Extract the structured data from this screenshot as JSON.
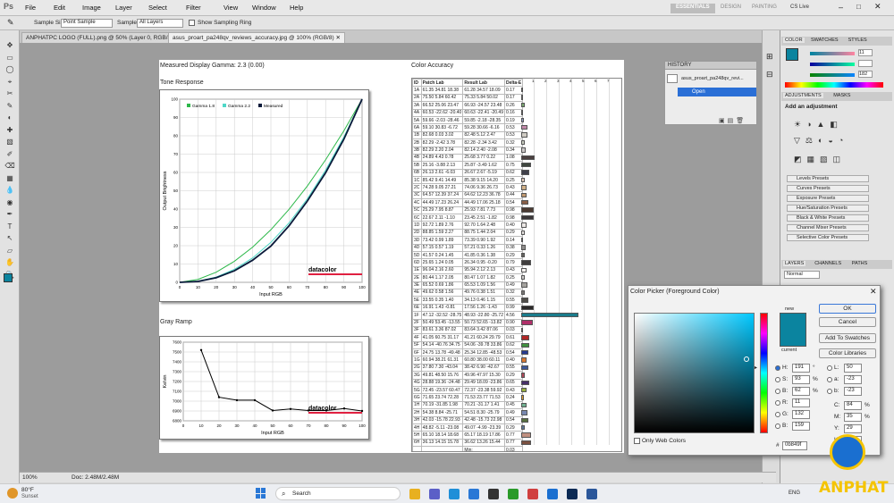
{
  "app": {
    "logo": "Ps"
  },
  "menu": [
    "File",
    "Edit",
    "Image",
    "Layer",
    "Select",
    "Filter",
    "View",
    "Window",
    "Help"
  ],
  "workspace": {
    "essentials": "ESSENTIALS",
    "design": "DESIGN",
    "painting": "PAINTING",
    "cslive": "CS Live"
  },
  "options": {
    "sample_size_label": "Sample Size:",
    "sample_size_value": "Point Sample",
    "sample_label": "Sample:",
    "sample_value": "All Layers",
    "show_ring": "Show Sampling Ring"
  },
  "tabs": [
    {
      "label": "ANPHATPC LOGO (FULL).png @ 50% (Layer 0, RGB/8) *"
    },
    {
      "label": "asus_proart_pa248qv_reviews_accuracy.jpg @ 100% (RGB/8)"
    }
  ],
  "doc": {
    "gamma_title": "Measured Display Gamma: 2.3 (0.00)",
    "tone_title": "Tone Response",
    "tone_ylabel": "Output Brightness",
    "tone_xlabel": "Input RGB",
    "legend": [
      "Gamma 1.8",
      "Gamma 2.2",
      "Measured"
    ],
    "gray_title": "Gray Ramp",
    "gray_ylabel": "Kelvin",
    "gray_xlabel": "Input RGB",
    "brand": "datacolor",
    "ca_title": "Color Accuracy",
    "ca_headers": [
      "ID",
      "Patch Lab",
      "Result Lab",
      "Delta-E"
    ],
    "ca_scale": [
      "1",
      "2",
      "3",
      "4",
      "5",
      "6",
      "7"
    ],
    "ca_rows": [
      [
        "1A",
        "61.35 34.81 18.38",
        "61.28 34.57 18.09",
        "0.17",
        "#c89a8a"
      ],
      [
        "2A",
        "75.50 5.84 60.42",
        "75.33 5.84 50.02",
        "0.17",
        "#d8c47a"
      ],
      [
        "3A",
        "66.52 25.06 23.47",
        "66.93 -24.57 23.48",
        "0.26",
        "#7aa870"
      ],
      [
        "4A",
        "60.53 -22.62 -20.40",
        "60.63 -22.41 -20.49",
        "0.16",
        "#5aa0b0"
      ],
      [
        "5A",
        "59.66 -2.03 -28.46",
        "59.85 -2.18 -28.35",
        "0.19",
        "#8898c0"
      ],
      [
        "6A",
        "59.10 30.83 -6.72",
        "59.28 30.66 -6.16",
        "0.53",
        "#c088a8"
      ],
      [
        "1B",
        "82.68 0.03 3.02",
        "82.48 5.12 2.47",
        "0.53",
        "#d0ccc4"
      ],
      [
        "2B",
        "82.29 -2.42 3.78",
        "82.28 -2.34 3.42",
        "0.32",
        "#c8ccc0"
      ],
      [
        "3B",
        "82.29 2.20 2.04",
        "82.14 2.40 -2.08",
        "0.34",
        "#ccc8c8"
      ],
      [
        "4B",
        "24.89 4.43 0.78",
        "25.68 3.77 0.22",
        "1.08",
        "#4a4040"
      ],
      [
        "5B",
        "25.16 -3.88 2.13",
        "25.87 -3.49 1.62",
        "0.75",
        "#3e463e"
      ],
      [
        "6B",
        "26.13 2.61 -6.03",
        "26.67 2.67 -5.19",
        "0.62",
        "#40404a"
      ],
      [
        "1C",
        "85.42 9.41 14.49",
        "85.38 9.15 14.20",
        "0.25",
        "#e0c8b8"
      ],
      [
        "2C",
        "74.28 9.05 27.21",
        "74.06 9.36 26.73",
        "0.43",
        "#d0b088"
      ],
      [
        "3C",
        "64.57 12.39 37.24",
        "64.62 12.23 36.78",
        "0.44",
        "#c09870"
      ],
      [
        "4C",
        "44.49 17.23 26.24",
        "44.49 17.06 25.18",
        "0.54",
        "#8a6048"
      ],
      [
        "5C",
        "25.29 7.95 8.87",
        "25.93 7.81 7.73",
        "0.98",
        "#4a3a32"
      ],
      [
        "6C",
        "22.67 2.11 -1.10",
        "23.45 2.51 -1.82",
        "0.98",
        "#3a3638"
      ],
      [
        "1D",
        "92.72 1.89 2.76",
        "92.70 1.64 2.48",
        "0.40",
        "#ece8e6"
      ],
      [
        "2D",
        "88.85 1.59 2.27",
        "88.75 1.44 2.04",
        "0.29",
        "#e2dedc"
      ],
      [
        "3D",
        "73.42 0.99 1.89",
        "73.39 0.90 1.92",
        "0.14",
        "#bab6b4"
      ],
      [
        "4D",
        "57.15 0.57 1.19",
        "57.21 0.33 1.26",
        "0.38",
        "#8e8c8a"
      ],
      [
        "5D",
        "41.57 0.24 1.45",
        "41.85 0.36 1.38",
        "0.29",
        "#64625e"
      ],
      [
        "6D",
        "25.65 1.24 0.05",
        "26.34 0.95 -0.20",
        "0.79",
        "#403e3e"
      ],
      [
        "1E",
        "96.04 2.16 2.60",
        "95.94 2.12 2.13",
        "0.43",
        "#f4f0ee"
      ],
      [
        "2E",
        "80.44 1.17 2.05",
        "80.47 1.07 1.82",
        "0.25",
        "#cccac8"
      ],
      [
        "3E",
        "65.52 0.69 1.86",
        "65.53 1.09 1.56",
        "0.49",
        "#a4a29e"
      ],
      [
        "4E",
        "49.62 0.58 1.56",
        "49.76 0.38 1.51",
        "0.32",
        "#7a7876"
      ],
      [
        "5E",
        "33.55 0.35 1.40",
        "34.13 0.46 1.15",
        "0.55",
        "#504e4a"
      ],
      [
        "6E",
        "16.91 1.43 -0.81",
        "17.56 1.26 -1.43",
        "0.99",
        "#2a2828"
      ],
      [
        "1F",
        "47.12 -32.52 -28.75",
        "48.93 -22.80 -25.72",
        "4.56",
        "#1a7c8c"
      ],
      [
        "2F",
        "50.49 53.45 -13.55",
        "50.73 52.65 -13.82",
        "0.90",
        "#b0306a"
      ],
      [
        "3F",
        "83.61 3.36 87.02",
        "83.64 3.42 87.06",
        "0.03",
        "#e8d020"
      ],
      [
        "4F",
        "41.05 60.75 31.17",
        "41.21 60.24 29.79",
        "0.61",
        "#b02828"
      ],
      [
        "5F",
        "54.14 -40.76 34.75",
        "54.06 -39.78 33.86",
        "0.62",
        "#409040"
      ],
      [
        "6F",
        "24.75 13.78 -49.48",
        "25.34 12.85 -48.53",
        "0.54",
        "#283c90"
      ],
      [
        "1G",
        "60.94 38.21 61.31",
        "60.80 38.00 60.11",
        "0.40",
        "#d87830"
      ],
      [
        "2G",
        "37.80 7.30 -43.04",
        "38.42 6.90 -42.67",
        "0.55",
        "#3c5898"
      ],
      [
        "3G",
        "49.81 48.50 15.76",
        "49.96 47.97 15.30",
        "0.29",
        "#b04858"
      ],
      [
        "4G",
        "28.88 19.36 -24.48",
        "29.49 18.09 -23.86",
        "0.65",
        "#483068"
      ],
      [
        "5G",
        "72.45 -23.57 60.47",
        "72.37 -23.38 59.92",
        "0.43",
        "#98b040"
      ],
      [
        "6G",
        "71.65 23.74 72.28",
        "71.53 23.77 71.53",
        "0.24",
        "#e0a030"
      ],
      [
        "1H",
        "70.19 -31.85 1.98",
        "70.21 -31.17 1.41",
        "0.45",
        "#70b090"
      ],
      [
        "2H",
        "54.38 8.84 -25.71",
        "54.51 8.30 -25.79",
        "0.49",
        "#7888b0"
      ],
      [
        "3H",
        "42.03 -15.78 22.93",
        "42.48 -15.73 22.98",
        "0.54",
        "#587040"
      ],
      [
        "4H",
        "48.82 -5.11 -23.08",
        "49.07 -4.99 -23.39",
        "0.29",
        "#607898"
      ],
      [
        "5H",
        "65.10 18.14 18.68",
        "65.17 18.19 17.86",
        "0.77",
        "#c09080"
      ],
      [
        "6H",
        "36.13 14.15 15.78",
        "36.62 13.26 15.44",
        "0.77",
        "#7a5040"
      ]
    ],
    "ca_summary": [
      [
        "Min:",
        "0.03"
      ],
      [
        "Max:",
        "4.56"
      ],
      [
        "Average",
        "0.53"
      ]
    ]
  },
  "history": {
    "title": "HISTORY",
    "file": "asus_proart_pa248qv_revi...",
    "open": "Open"
  },
  "color_panel": {
    "tabs": [
      "COLOR",
      "SWATCHES",
      "STYLES"
    ],
    "r": "11",
    "g": "",
    "b": "182"
  },
  "adjustments": {
    "tabs": [
      "ADJUSTMENTS",
      "MASKS"
    ],
    "add_label": "Add an adjustment",
    "presets": [
      "Levels Presets",
      "Curves Presets",
      "Exposure Presets",
      "Hue/Saturation Presets",
      "Black & White Presets",
      "Channel Mixer Presets",
      "Selective Color Presets"
    ]
  },
  "layers": {
    "tabs": [
      "LAYERS",
      "CHANNELS",
      "PATHS"
    ],
    "mode": "Normal"
  },
  "color_picker": {
    "title": "Color Picker (Foreground Color)",
    "ok": "OK",
    "cancel": "Cancel",
    "add_swatches": "Add To Swatches",
    "color_libraries": "Color Libraries",
    "new_label": "new",
    "current_label": "current",
    "only_web": "Only Web Colors",
    "fields": [
      [
        "H:",
        "191",
        "°"
      ],
      [
        "S:",
        "93",
        "%"
      ],
      [
        "B:",
        "62",
        "%"
      ],
      [
        "R:",
        "11",
        ""
      ],
      [
        "G:",
        "132",
        ""
      ],
      [
        "B:",
        "159",
        ""
      ]
    ],
    "lab": [
      [
        "L:",
        "50"
      ],
      [
        "a:",
        "-23"
      ],
      [
        "b:",
        "-23"
      ]
    ],
    "cmyk": [
      [
        "C:",
        "84",
        "%"
      ],
      [
        "M:",
        "35",
        "%"
      ],
      [
        "Y:",
        "29",
        ""
      ],
      [
        "K:",
        "",
        ""
      ]
    ],
    "hex": "0b849f",
    "color": "#0b849f"
  },
  "status": {
    "zoom": "100%",
    "doc": "Doc: 2.48M/2.48M"
  },
  "taskbar": {
    "weather_temp": "80°F",
    "weather_desc": "Sunset",
    "search": "Search",
    "lang": "ENG"
  },
  "watermark": "ANPHAT",
  "chart_data": [
    {
      "type": "line",
      "title": "Tone Response",
      "xlabel": "Input RGB",
      "ylabel": "Output Brightness",
      "x": [
        0,
        10,
        20,
        30,
        40,
        50,
        60,
        70,
        80,
        90,
        100
      ],
      "xlim": [
        0,
        100
      ],
      "ylim": [
        0,
        100
      ],
      "series": [
        {
          "name": "Gamma 1.8",
          "values": [
            0,
            1.6,
            5.5,
            11.5,
            19.2,
            28.7,
            39.9,
            52.6,
            66.9,
            82.7,
            100
          ],
          "color": "#2db84a"
        },
        {
          "name": "Gamma 2.2",
          "values": [
            0,
            0.6,
            2.9,
            7.1,
            13.3,
            21.8,
            32.5,
            45.6,
            61.2,
            79.3,
            100
          ],
          "color": "#4fd8c8"
        },
        {
          "name": "Measured",
          "values": [
            0,
            0.5,
            2.5,
            6.3,
            12.1,
            19.8,
            30.9,
            44.4,
            59.8,
            78.1,
            100
          ],
          "color": "#0a1a3a"
        }
      ]
    },
    {
      "type": "line",
      "title": "Gray Ramp",
      "xlabel": "Input RGB",
      "ylabel": "Kelvin",
      "x": [
        10,
        20,
        30,
        40,
        50,
        60,
        70,
        80,
        90,
        100
      ],
      "xlim": [
        0,
        100
      ],
      "ylim": [
        6800,
        7600
      ],
      "yticks": [
        6800,
        6900,
        7000,
        7100,
        7200,
        7300,
        7400,
        7500,
        7600
      ],
      "series": [
        {
          "name": "",
          "values": [
            7520,
            7040,
            7010,
            7010,
            6905,
            6920,
            6905,
            6905,
            6925,
            6900
          ],
          "color": "#000000"
        }
      ]
    }
  ]
}
